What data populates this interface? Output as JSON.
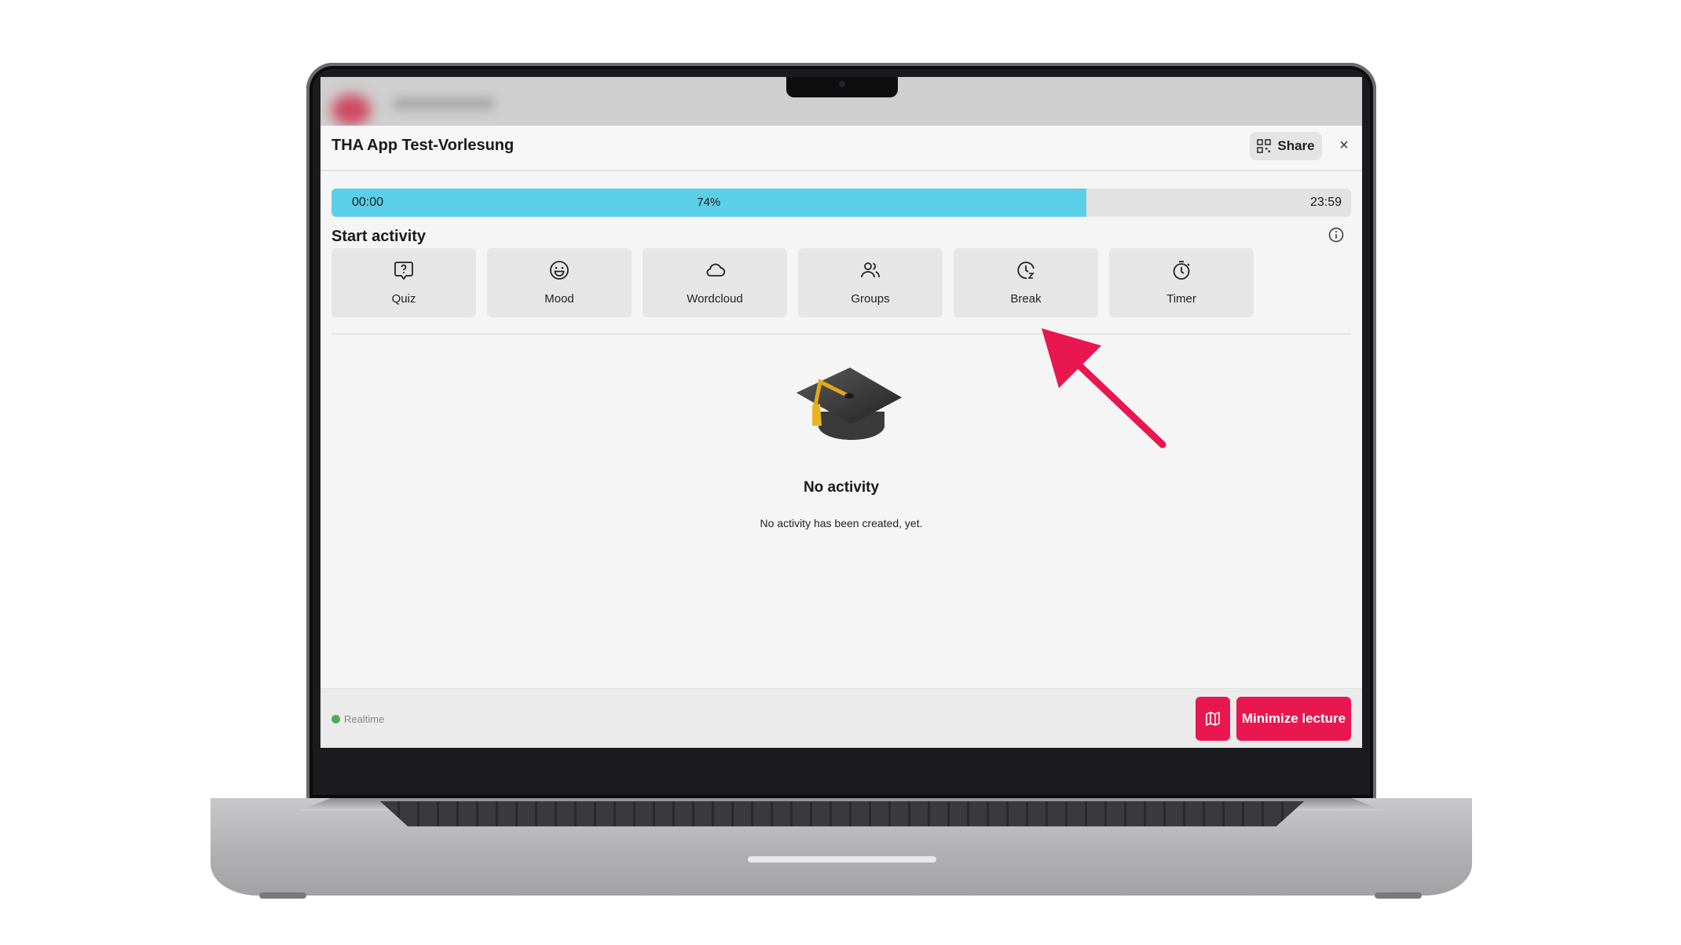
{
  "window": {
    "title": "THA App Test-Vorlesung",
    "share_label": "Share",
    "close_symbol": "×"
  },
  "progress": {
    "start_time": "00:00",
    "end_time": "23:59",
    "percent_label": "74%",
    "fraction": 0.74,
    "fill_color": "#5ccfe8"
  },
  "activities": {
    "title": "Start activity",
    "items": [
      {
        "label": "Quiz",
        "icon": "quiz-bubble-icon"
      },
      {
        "label": "Mood",
        "icon": "smiley-icon"
      },
      {
        "label": "Wordcloud",
        "icon": "cloud-icon"
      },
      {
        "label": "Groups",
        "icon": "users-icon"
      },
      {
        "label": "Break",
        "icon": "clock-icon"
      },
      {
        "label": "Timer",
        "icon": "stopwatch-icon"
      }
    ]
  },
  "empty_state": {
    "title": "No activity",
    "subtitle": "No activity has been created, yet.",
    "icon": "graduation-cap-icon"
  },
  "footer": {
    "status_label": "Realtime",
    "status_color": "#4caf50",
    "minimize_label": "Minimize lecture",
    "map_icon": "map-icon",
    "accent_color": "#e8174f"
  },
  "annotation": {
    "arrow_color": "#e8174f",
    "points_to": "Break"
  }
}
